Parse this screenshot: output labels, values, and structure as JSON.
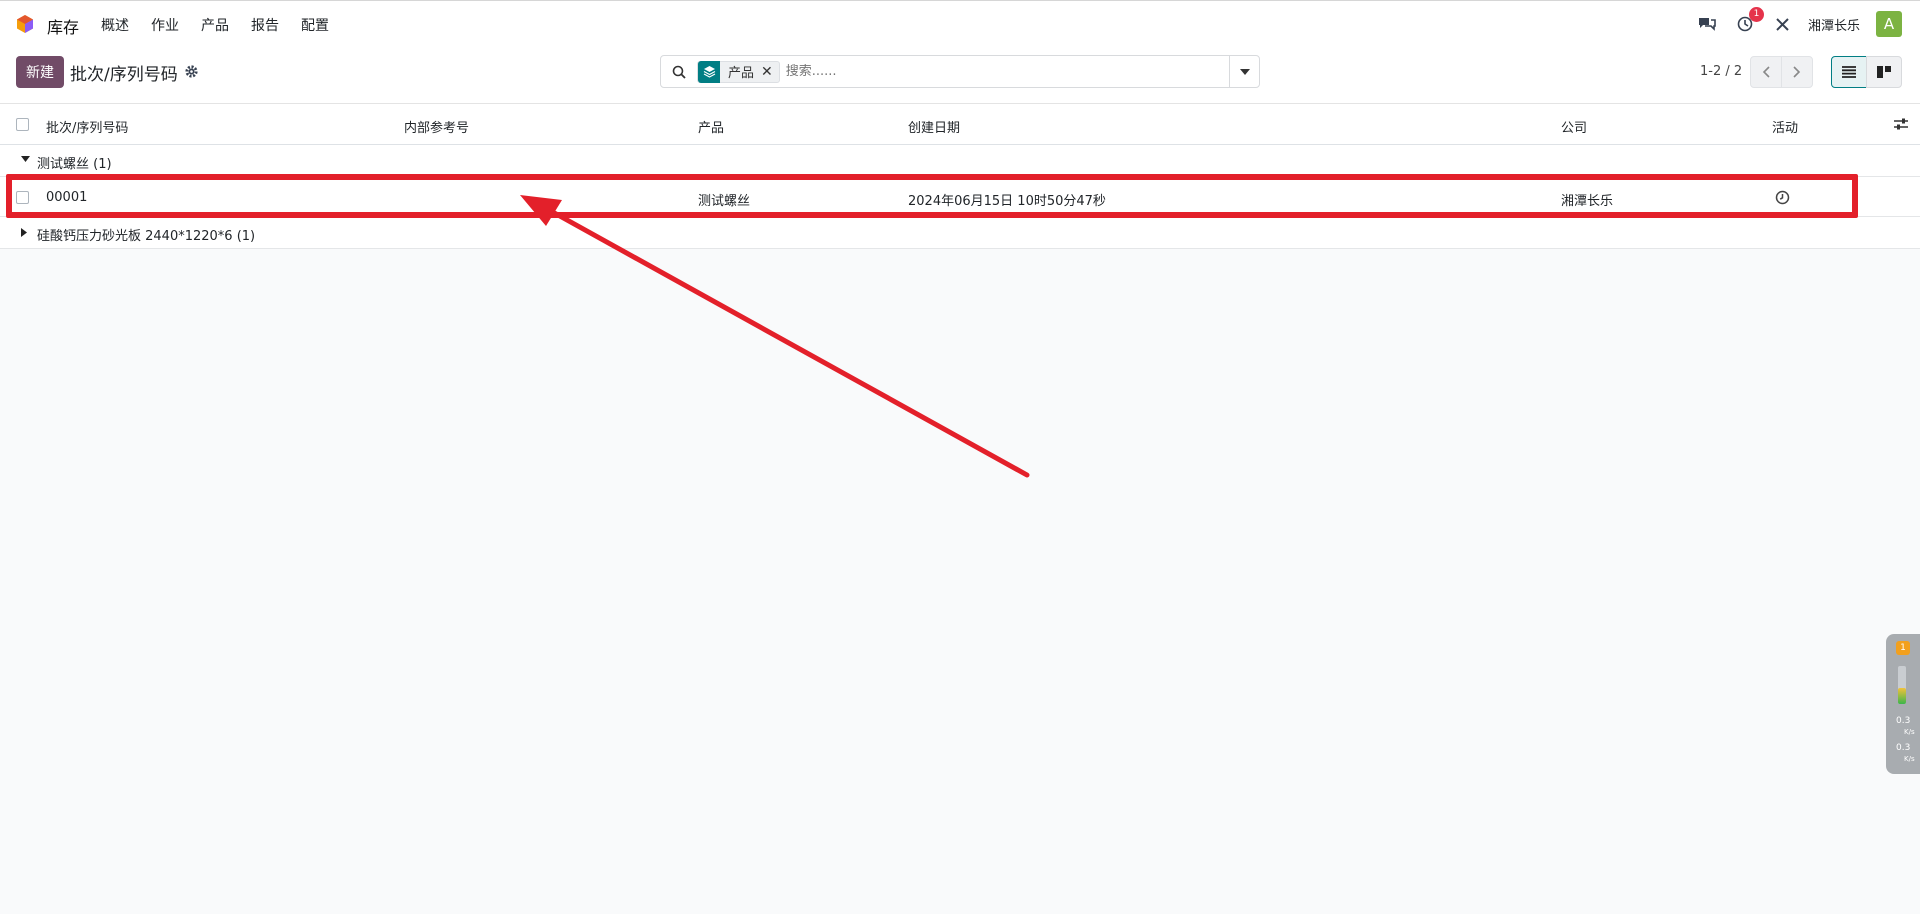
{
  "navbar": {
    "app_name": "库存",
    "menu": [
      "概述",
      "作业",
      "产品",
      "报告",
      "配置"
    ],
    "activity_badge": "1",
    "company": "湘潭长乐",
    "avatar_letter": "A",
    "colors": {
      "avatar_bg": "#7cb342",
      "badge_bg": "#e5334b"
    }
  },
  "control": {
    "new_label": "新建",
    "breadcrumb": "批次/序列号码",
    "search": {
      "facet_label": "产品",
      "placeholder": "搜索......"
    },
    "pager": "1-2 / 2",
    "colors": {
      "primary": "#714b67",
      "facet": "#017e84"
    }
  },
  "list": {
    "columns": [
      "批次/序列号码",
      "内部参考号",
      "产品",
      "创建日期",
      "公司",
      "活动"
    ],
    "groups": [
      {
        "label": "测试螺丝 (1)",
        "expanded": true,
        "rows": [
          {
            "lot": "00001",
            "internal_ref": "",
            "product": "测试螺丝",
            "created": "2024年06月15日 10时50分47秒",
            "company": "湘潭长乐",
            "activity_icon": "clock-icon"
          }
        ]
      },
      {
        "label": "硅酸钙压力砂光板 2440*1220*6 (1)",
        "expanded": false,
        "rows": []
      }
    ]
  },
  "widget": {
    "badge": "1",
    "upload_value": "0.3",
    "upload_unit": "K/s",
    "download_value": "0.3",
    "download_unit": "K/s"
  },
  "annotation": {
    "highlight_color": "#e3202a"
  }
}
